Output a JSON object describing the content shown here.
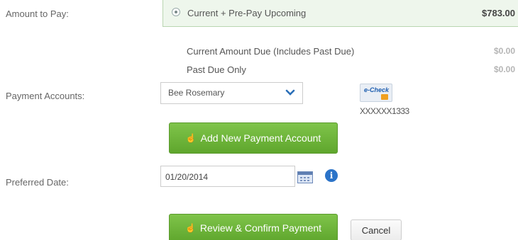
{
  "amount_to_pay": {
    "label": "Amount to Pay:",
    "options": [
      {
        "label": "Current + Pre-Pay Upcoming",
        "amount": "$783.00",
        "selected": true
      },
      {
        "label": "Current Amount Due (Includes Past Due)",
        "amount": "$0.00",
        "selected": false
      },
      {
        "label": "Past Due Only",
        "amount": "$0.00",
        "selected": false
      }
    ]
  },
  "payment_accounts": {
    "label": "Payment Accounts:",
    "selected_value": "Bee Rosemary",
    "account_type_icon": "e-check-icon",
    "echeck_text": "e-Check",
    "masked_account": "XXXXXX1333",
    "add_button_label": "Add New Payment Account"
  },
  "preferred_date": {
    "label": "Preferred Date:",
    "value": "01/20/2014",
    "calendar_icon": "calendar-icon",
    "info_icon": "info-icon",
    "info_glyph": "i"
  },
  "actions": {
    "review_label": "Review & Confirm Payment",
    "cancel_label": "Cancel"
  },
  "colors": {
    "primary_button": "#6db33f",
    "selected_row_bg": "#eef6ec",
    "info_blue": "#2b73c8"
  }
}
